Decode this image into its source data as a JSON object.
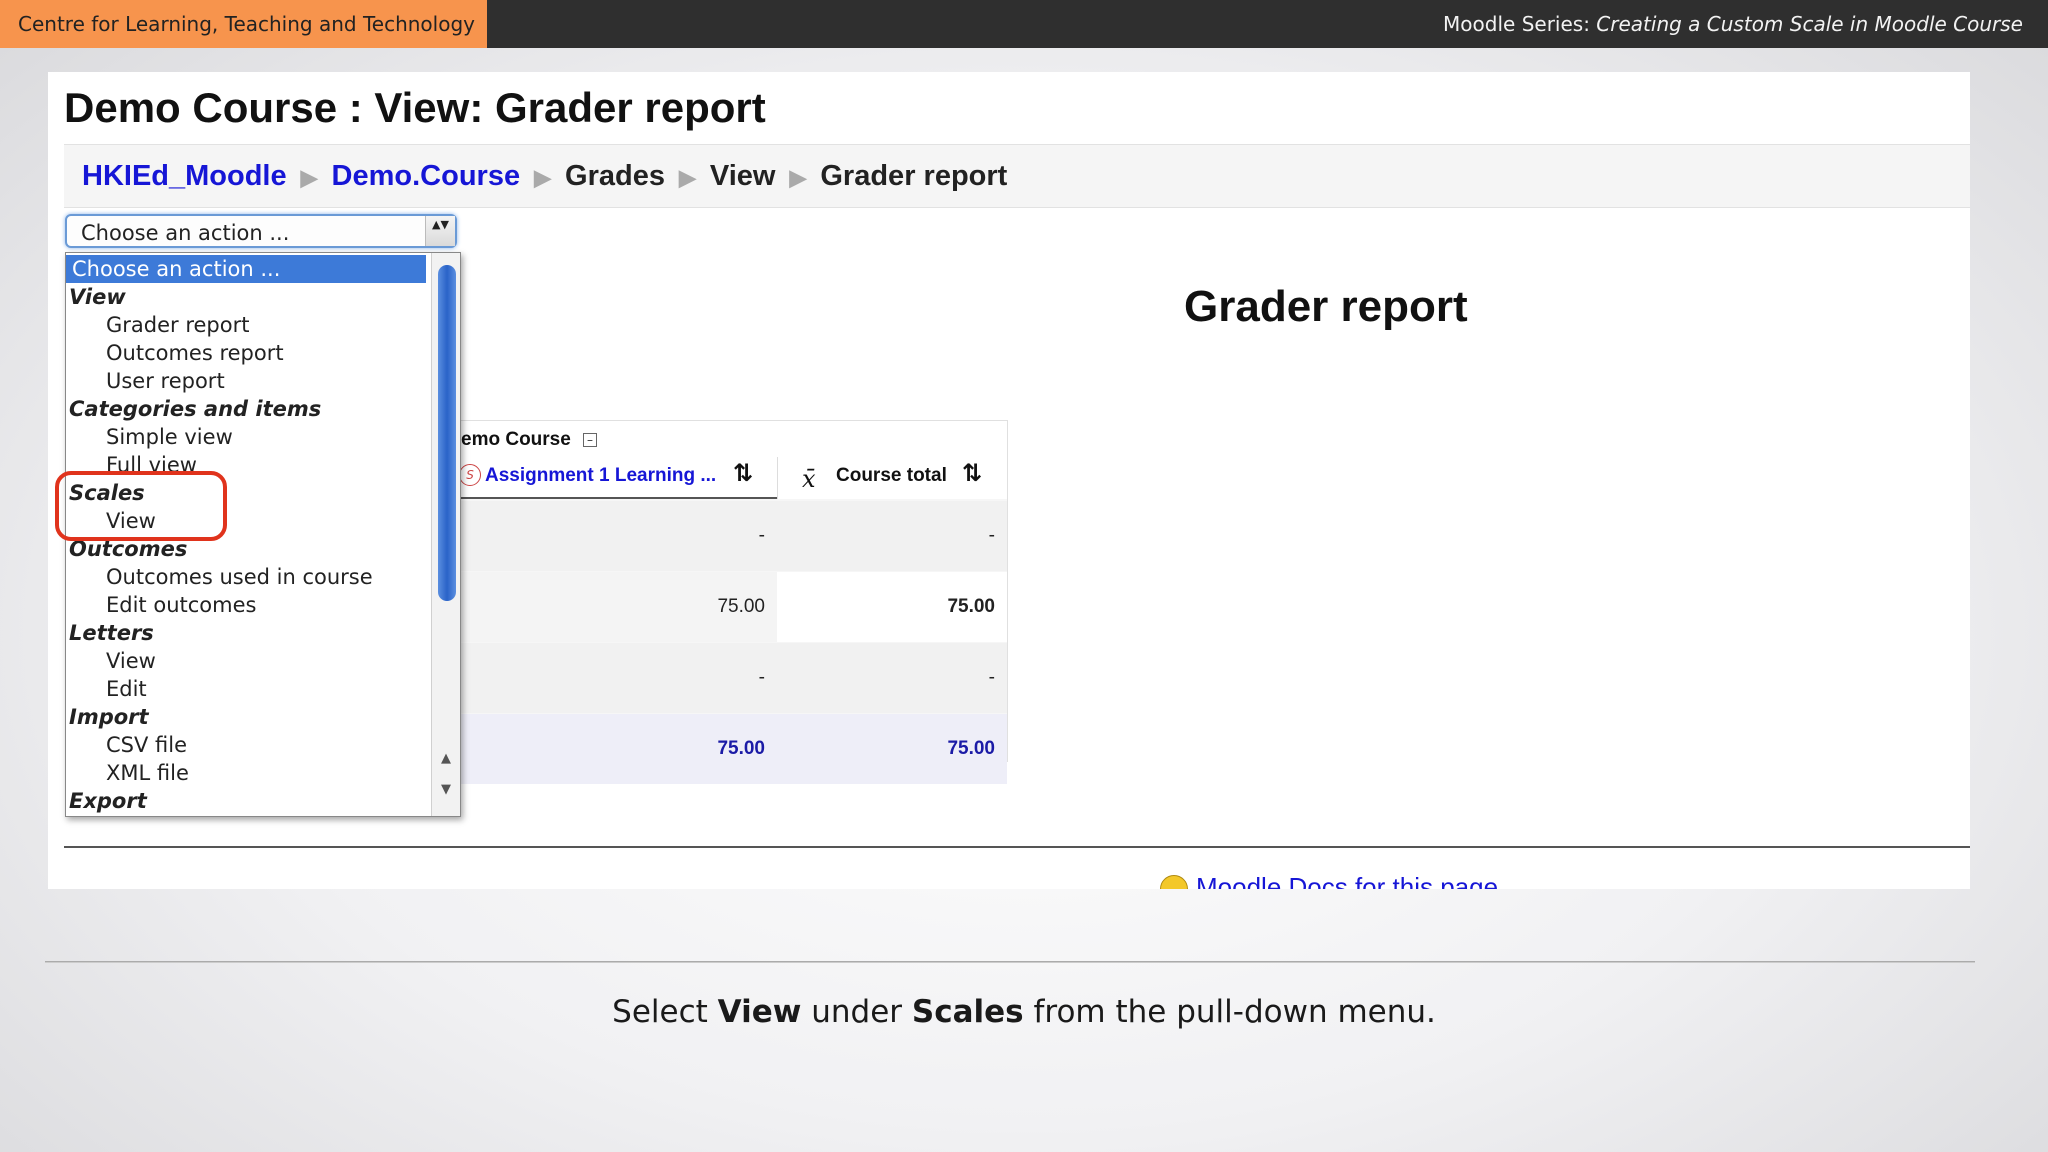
{
  "banner": {
    "left": "Centre for Learning, Teaching and Technology",
    "right_prefix": "Moodle Series: ",
    "right_title": "Creating a Custom Scale in Moodle Course"
  },
  "page": {
    "title": "Demo Course : View: Grader report",
    "report_heading": "Grader report"
  },
  "breadcrumb": [
    {
      "label": "HKIEd_Moodle",
      "link": true
    },
    {
      "label": "Demo.Course",
      "link": true
    },
    {
      "label": "Grades",
      "link": false
    },
    {
      "label": "View",
      "link": false
    },
    {
      "label": "Grader report",
      "link": false
    }
  ],
  "breadcrumb_separator": "▶",
  "action_select": {
    "value": "Choose an action ...",
    "arrows": "▲▼"
  },
  "dropdown": [
    {
      "type": "selected",
      "label": "Choose an action ..."
    },
    {
      "type": "group",
      "label": "View"
    },
    {
      "type": "option",
      "label": "Grader report"
    },
    {
      "type": "option",
      "label": "Outcomes report"
    },
    {
      "type": "option",
      "label": "User report"
    },
    {
      "type": "group",
      "label": "Categories and items"
    },
    {
      "type": "option",
      "label": "Simple view"
    },
    {
      "type": "option",
      "label": "Full view"
    },
    {
      "type": "group",
      "label": "Scales"
    },
    {
      "type": "option",
      "label": "View"
    },
    {
      "type": "group",
      "label": "Outcomes"
    },
    {
      "type": "option",
      "label": "Outcomes used in course"
    },
    {
      "type": "option",
      "label": "Edit outcomes"
    },
    {
      "type": "group",
      "label": "Letters"
    },
    {
      "type": "option",
      "label": "View"
    },
    {
      "type": "option",
      "label": "Edit"
    },
    {
      "type": "group",
      "label": "Import"
    },
    {
      "type": "option",
      "label": "CSV file"
    },
    {
      "type": "option",
      "label": "XML file"
    },
    {
      "type": "group",
      "label": "Export"
    }
  ],
  "grader_table": {
    "category": "emo Course",
    "collapse": "–",
    "assignment_icon": "S",
    "assignment_link": "Assignment 1 Learning ...",
    "sort_icon": "⇅",
    "total_symbol": "x̄",
    "total_label": "Course total",
    "rows": [
      [
        "-",
        "-"
      ],
      [
        "75.00",
        "75.00"
      ],
      [
        "-",
        "-"
      ],
      [
        "75.00",
        "75.00"
      ]
    ]
  },
  "footer_link": "Moodle Docs for this page",
  "caption": {
    "p1": "Select ",
    "b1": "View",
    "p2": " under ",
    "b2": "Scales",
    "p3": " from the pull-down menu."
  }
}
